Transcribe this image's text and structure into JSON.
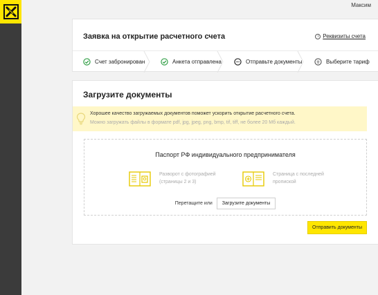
{
  "user": {
    "name": "Максим"
  },
  "header": {
    "title": "Заявка на открытие расчетного счета",
    "requisites_label": "Реквизиты счета",
    "steps": [
      {
        "label": "Счет забронирован",
        "status": "done"
      },
      {
        "label": "Анкета отправлена",
        "status": "done"
      },
      {
        "label": "Отправьте документы",
        "status": "current"
      },
      {
        "label": "Выберите тариф",
        "status": "pending"
      }
    ]
  },
  "upload": {
    "title": "Загрузите документы",
    "notice": {
      "line1": "Хорошее качество загружаемых документов поможет ускорить открытие расчетного счета.",
      "line2": "Можно загружать файлы в формате pdf, jpg, jpeg, png, bmp, tif, tiff, не более 20 Мб каждый."
    },
    "dropzone": {
      "title": "Паспорт РФ индивидуального предпринимателя",
      "doc1": "Разворот с фотографией (страницы 2 и 3)",
      "doc2": "Страница с последней пропиской",
      "drag_text": "Перетащите или",
      "upload_button": "Загрузите документы"
    },
    "send_button": "Отправить документы"
  },
  "colors": {
    "brand_yellow": "#fee600",
    "check_green": "#2f9e44",
    "notice_bg": "#fff7c8",
    "rail": "#3b3b3b"
  },
  "icons": {
    "logo": "raiffeisen-logo",
    "done": "check-circle-icon",
    "current": "dots-circle-icon",
    "pending": "tariff-circle-icon"
  }
}
